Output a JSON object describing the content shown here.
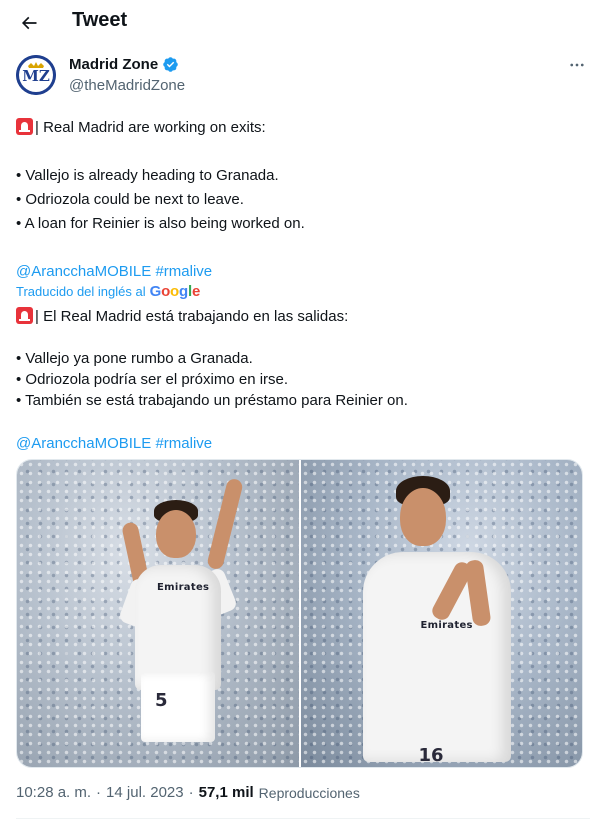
{
  "header": {
    "title": "Tweet",
    "back_icon": "arrow-left-icon"
  },
  "author": {
    "display_name": "Madrid Zone",
    "handle": "@theMadridZone",
    "avatar_text": "MZ",
    "verified": true,
    "verified_color": "#1d9bf0",
    "more_icon": "more-horizontal-icon"
  },
  "tweet": {
    "original": {
      "line1": "| Real Madrid are working on exits:",
      "bullet1": "• Vallejo is already heading to Granada.",
      "bullet2": "• Odriozola could be next to leave.",
      "bullet3": "• A loan for Reinier is also being worked on.",
      "mention": "@ArancchaMOBILE",
      "hashtag": "#rmalive"
    },
    "translated_by": {
      "label": "Traducido del inglés al",
      "provider": "Google"
    },
    "translation": {
      "line1": "| El Real Madrid está trabajando en las salidas:",
      "bullet1": "• Vallejo ya pone rumbo a Granada.",
      "bullet2": "• Odriozola podría ser el próximo en irse.",
      "bullet3": "• También se está trabajando un préstamo para Reinier on.",
      "mention": "@ArancchaMOBILE",
      "hashtag": "#rmalive"
    },
    "siren_icon": "police-light-emoji"
  },
  "media": {
    "photos": [
      {
        "alt": "Vallejo",
        "jersey_sponsor": "Emirates",
        "number": "5"
      },
      {
        "alt": "Odriozola",
        "jersey_sponsor": "Emirates",
        "number": "16"
      }
    ]
  },
  "meta": {
    "time": "10:28 a. m.",
    "separator": "·",
    "date": "14 jul. 2023",
    "views_count": "57,1 mil",
    "views_label": "Reproducciones"
  },
  "colors": {
    "link": "#1d9bf0",
    "text_primary": "#0f1419",
    "text_secondary": "#536471"
  }
}
